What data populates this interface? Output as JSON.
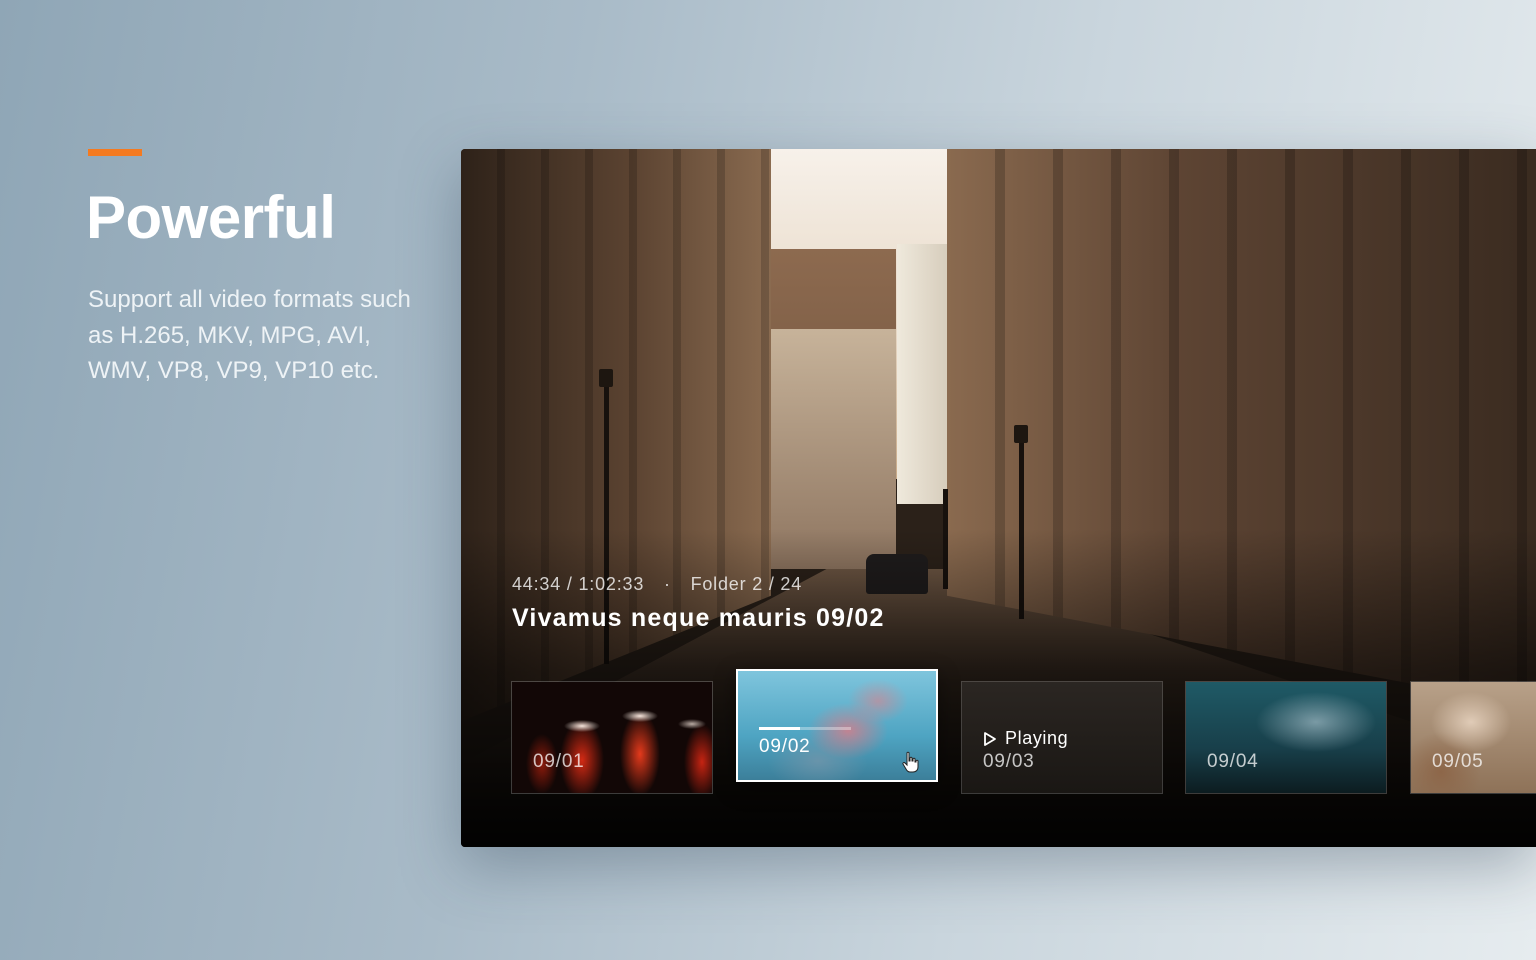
{
  "feature": {
    "title": "Powerful",
    "description": "Support all video formats such as H.265, MKV, MPG, AVI, WMV, VP8, VP9, VP10 etc.",
    "accent_color": "#f47a20"
  },
  "player": {
    "elapsed": "44:34",
    "duration": "1:02:33",
    "time_separator": "/",
    "meta_dot": "·",
    "folder_label": "Folder",
    "folder_position": "2 / 24",
    "video_title": "Vivamus neque mauris 09/02",
    "thumbnails": [
      {
        "label": "09/01"
      },
      {
        "label": "09/02",
        "selected": true,
        "progress": 0.45
      },
      {
        "label": "09/03",
        "status": "Playing",
        "status_icon": "play-icon"
      },
      {
        "label": "09/04"
      },
      {
        "label": "09/05"
      }
    ]
  }
}
